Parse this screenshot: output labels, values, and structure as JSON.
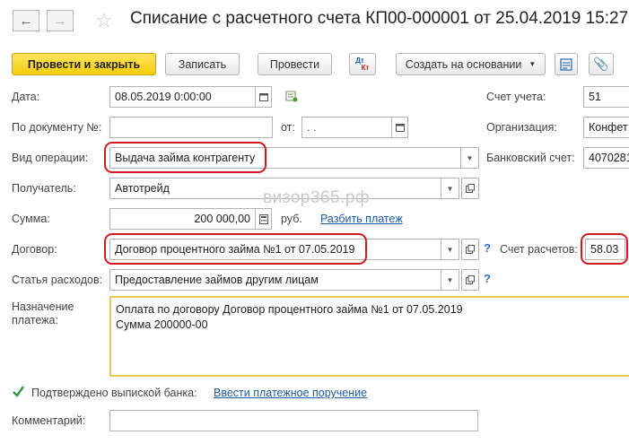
{
  "window": {
    "title": "Списание с расчетного счета КП00-000001 от 25.04.2019 15:27"
  },
  "toolbar": {
    "post_close": "Провести и закрыть",
    "save": "Записать",
    "post": "Провести",
    "dtkt_top": "Дт",
    "dtkt_bottom": "Кт",
    "create_based": "Создать на основании"
  },
  "form": {
    "date_label": "Дата:",
    "date_value": "08.05.2019  0:00:00",
    "doc_num_label": "По документу №:",
    "doc_num_value": "",
    "from_label": "от:",
    "from_value": " .  .",
    "op_type_label": "Вид операции:",
    "op_type_value": "Выдача займа контрагенту",
    "recipient_label": "Получатель:",
    "recipient_value": "Автотрейд",
    "amount_label": "Сумма:",
    "amount_value": "200 000,00",
    "currency": "руб.",
    "split_payment": "Разбить платеж",
    "contract_label": "Договор:",
    "contract_value": "Договор процентного займа №1 от 07.05.2019",
    "expense_label": "Статья расходов:",
    "expense_value": "Предоставление займов другим лицам",
    "purpose_label_1": "Назначение",
    "purpose_label_2": "платежа:",
    "purpose_line_1": "Оплата по договору Договор процентного займа №1 от 07.05.2019",
    "purpose_line_2": "Сумма 200000-00",
    "confirmed_label": "Подтверждено выпиской банка:",
    "enter_order": "Ввести платежное поручение",
    "comment_label": "Комментарий:",
    "comment_value": "",
    "help_mark": "?"
  },
  "right": {
    "account_label": "Счет учета:",
    "account_value": "51",
    "org_label": "Организация:",
    "org_value": "Конфет",
    "bank_label": "Банковский счет:",
    "bank_value": "4070281",
    "settle_label": "Счет расчетов:",
    "settle_value": "58.03"
  },
  "watermark": "визор365.рф",
  "colors": {
    "primary_button": "#f5cc0b",
    "highlight_oval": "#d2191f",
    "link": "#1f5ca6",
    "checkbox": "#2e9b3f"
  }
}
